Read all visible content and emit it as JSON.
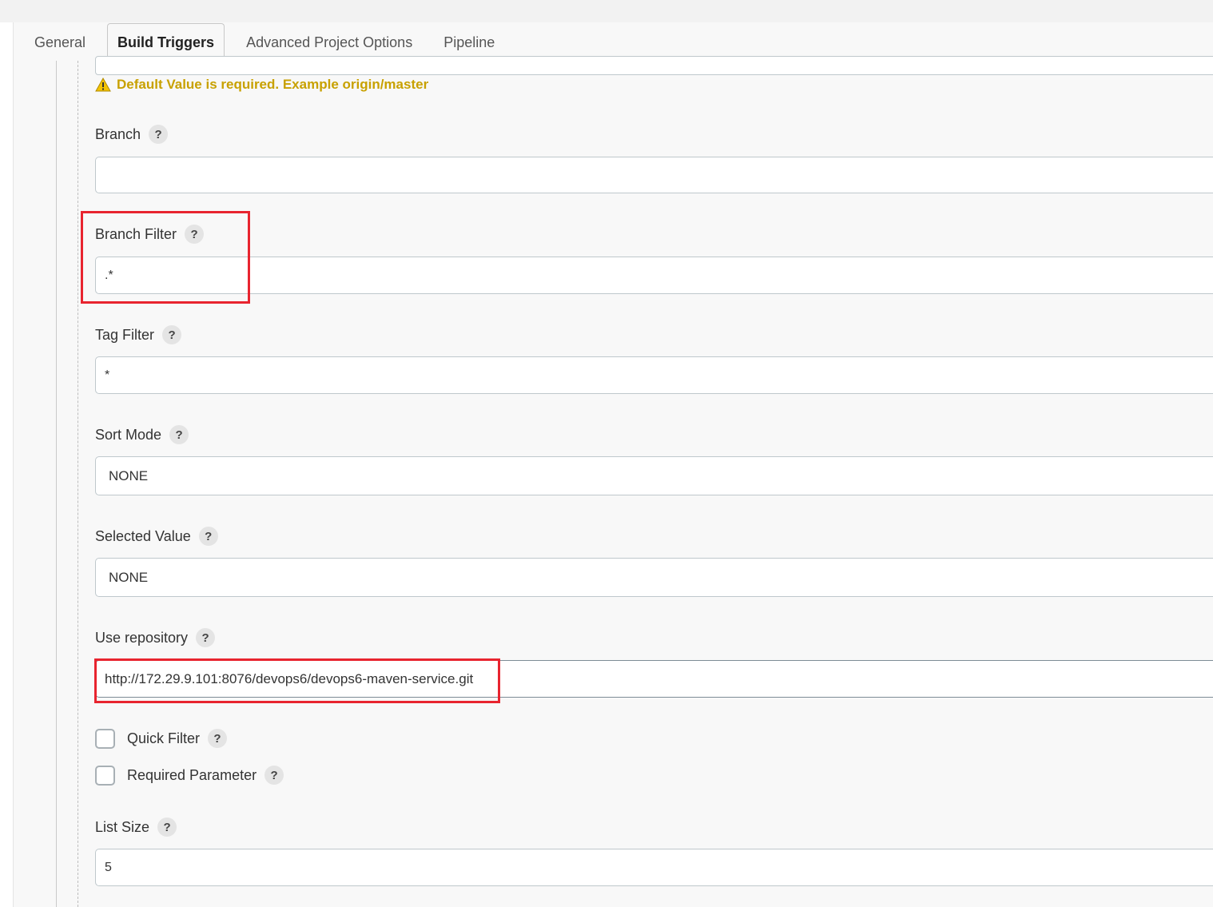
{
  "tabs": [
    {
      "label": "General",
      "active": false
    },
    {
      "label": "Build Triggers",
      "active": true
    },
    {
      "label": "Advanced Project Options",
      "active": false
    },
    {
      "label": "Pipeline",
      "active": false
    }
  ],
  "warning": {
    "icon": "warning-icon",
    "text": "Default Value is required. Example origin/master",
    "color": "#c8a100"
  },
  "help_glyph": "?",
  "fields": {
    "branch": {
      "label": "Branch",
      "value": ""
    },
    "branch_filter": {
      "label": "Branch Filter",
      "value": ".*"
    },
    "tag_filter": {
      "label": "Tag Filter",
      "value": "*"
    },
    "sort_mode": {
      "label": "Sort Mode",
      "value": "NONE"
    },
    "selected_value": {
      "label": "Selected Value",
      "value": "NONE"
    },
    "use_repository": {
      "label": "Use repository",
      "value": "http://172.29.9.101:8076/devops6/devops6-maven-service.git"
    },
    "quick_filter": {
      "label": "Quick Filter",
      "checked": false
    },
    "required_parameter": {
      "label": "Required Parameter",
      "checked": false
    },
    "list_size": {
      "label": "List Size",
      "value": "5"
    }
  },
  "colors": {
    "highlight": "#e8242f",
    "warning": "#c8a100",
    "panel_bg": "#f8f8f8"
  }
}
